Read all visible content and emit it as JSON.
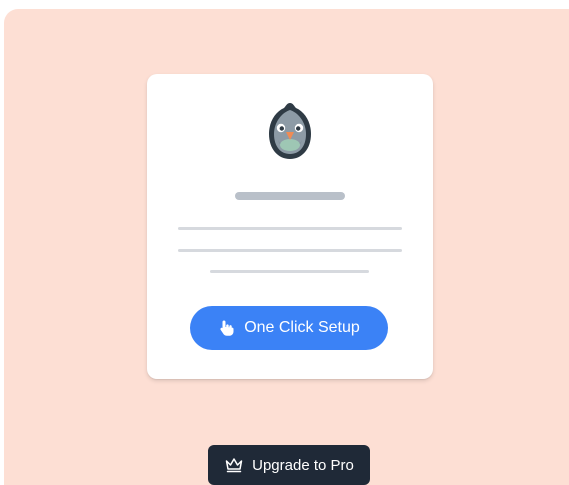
{
  "card": {
    "setup_button_label": "One Click Setup"
  },
  "footer": {
    "upgrade_button_label": "Upgrade to Pro"
  },
  "icons": {
    "mascot": "pigeon-mascot-icon",
    "setup": "hand-pointer-icon",
    "upgrade": "crown-icon"
  },
  "colors": {
    "background": "#fddfd4",
    "card": "#ffffff",
    "primary": "#3b82f6",
    "dark_button": "#1f2937",
    "placeholder_dark": "#b9c0c9",
    "placeholder_light": "#d6d9de"
  }
}
